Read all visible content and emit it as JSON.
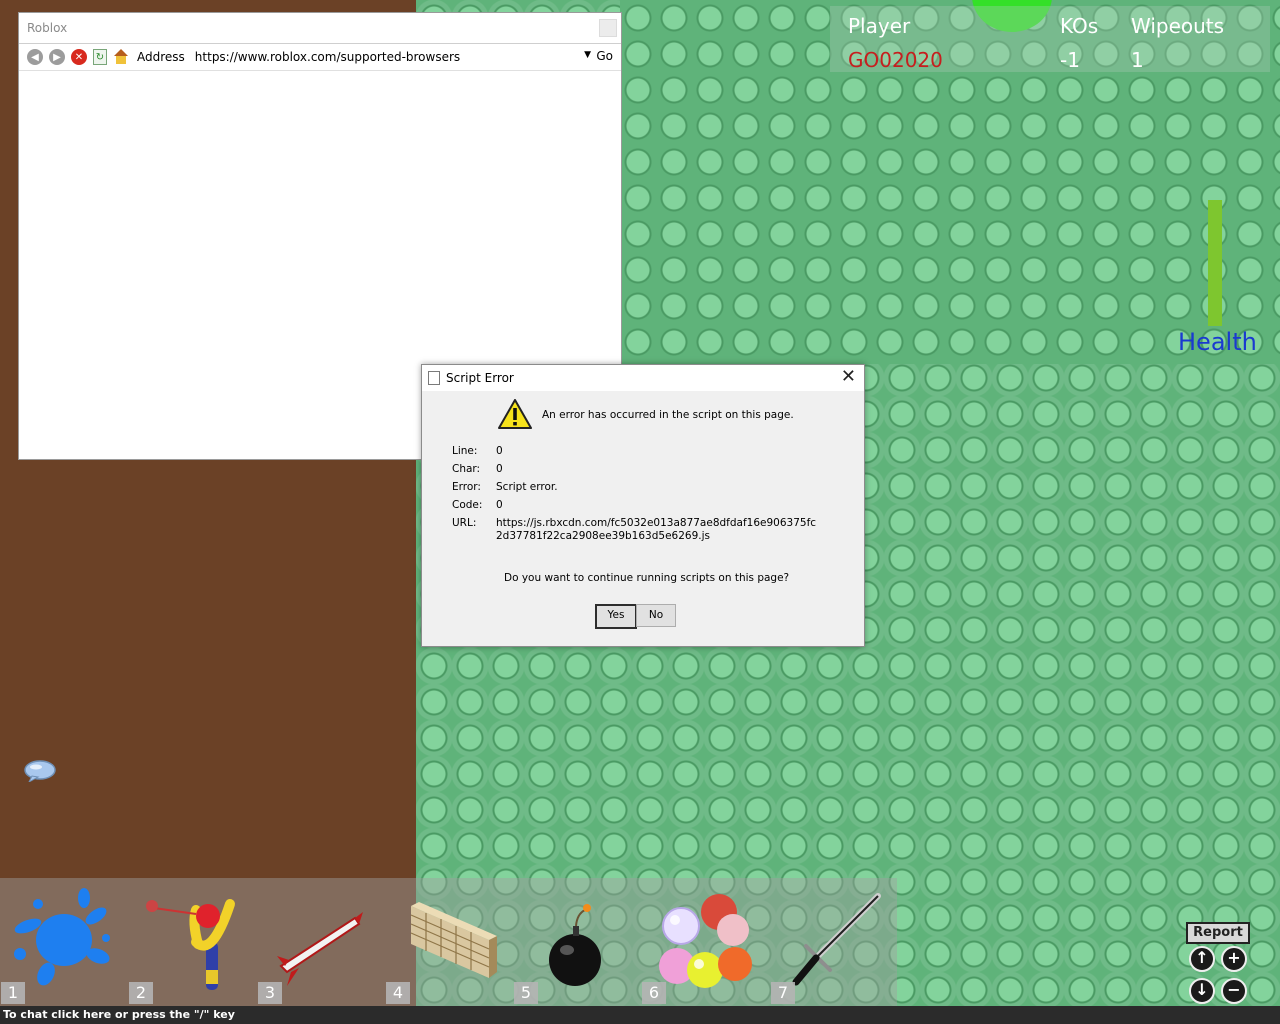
{
  "leaderboard": {
    "headers": [
      "Player",
      "KOs",
      "Wipeouts"
    ],
    "rows": [
      {
        "player": "GO02020",
        "kos": "-1",
        "wipeouts": "1"
      }
    ]
  },
  "health": {
    "label": "Health",
    "level": 1.0
  },
  "browser": {
    "title": "Roblox",
    "address_label": "Address",
    "address_value": "https://www.roblox.com/supported-browsers",
    "go_label": "Go"
  },
  "dialog": {
    "title": "Script Error",
    "close_glyph": "✕",
    "message": "An error has occurred in the script on this page.",
    "fields": [
      {
        "label": "Line:",
        "value": "0"
      },
      {
        "label": "Char:",
        "value": "0"
      },
      {
        "label": "Error:",
        "value": "Script error."
      },
      {
        "label": "Code:",
        "value": "0"
      },
      {
        "label": "URL:",
        "value": "https://js.rbxcdn.com/fc5032e013a877ae8dfdaf16e906375fc\n2d37781f22ca2908ee39b163d5e6269.js"
      }
    ],
    "question": "Do you want to continue running scripts on this page?",
    "yes_label": "Yes",
    "no_label": "No"
  },
  "toolbar": {
    "slots": [
      {
        "number": "1",
        "tool": "paint-splat"
      },
      {
        "number": "2",
        "tool": "slingshot"
      },
      {
        "number": "3",
        "tool": "rocket"
      },
      {
        "number": "4",
        "tool": "brick-wall"
      },
      {
        "number": "5",
        "tool": "bomb"
      },
      {
        "number": "6",
        "tool": "marbles"
      },
      {
        "number": "7",
        "tool": "sword"
      }
    ]
  },
  "chat": {
    "hint": "To chat click here or press the \"/\" key"
  },
  "controls": {
    "report_label": "Report",
    "zoom_in_glyph": "+",
    "zoom_out_glyph": "−",
    "cam_up_glyph": "↑",
    "cam_down_glyph": "↓"
  },
  "colors": {
    "player_name": "#c61e1e",
    "health_label": "#1a3ad0",
    "health_fill": "#7ec62f",
    "baseplate": "#5fb37a"
  }
}
